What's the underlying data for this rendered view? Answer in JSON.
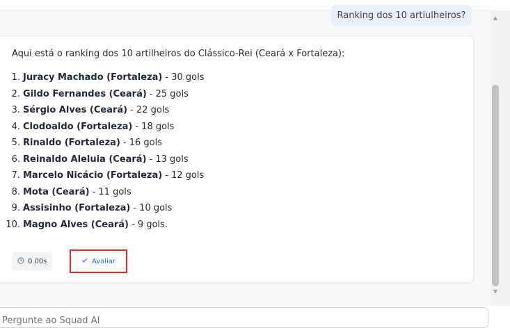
{
  "user_message": "Ranking dos 10 artiulheiros?",
  "assistant": {
    "intro": "Aqui está o ranking dos 10 artilheiros do Clássico-Rei (Ceará x Fortaleza):",
    "ranking": [
      {
        "num": "1.",
        "player": "Juracy Machado (Fortaleza)",
        "goals": "- 30 gols"
      },
      {
        "num": "2.",
        "player": "Gildo Fernandes (Ceará)",
        "goals": "- 25 gols"
      },
      {
        "num": "3.",
        "player": "Sérgio Alves (Ceará)",
        "goals": "- 22 gols"
      },
      {
        "num": "4.",
        "player": "Clodoaldo (Fortaleza)",
        "goals": "- 18 gols"
      },
      {
        "num": "5.",
        "player": "Rinaldo (Fortaleza)",
        "goals": "- 16 gols"
      },
      {
        "num": "6.",
        "player": "Reinaldo Aleluia (Ceará)",
        "goals": "- 13 gols"
      },
      {
        "num": "7.",
        "player": "Marcelo Nicácio (Fortaleza)",
        "goals": "- 12 gols"
      },
      {
        "num": "8.",
        "player": "Mota (Ceará)",
        "goals": "- 11 gols"
      },
      {
        "num": "9.",
        "player": "Assisinho (Fortaleza)",
        "goals": "- 10 gols"
      },
      {
        "num": "10.",
        "player": "Magno Alves (Ceará)",
        "goals": "- 9 gols."
      }
    ],
    "response_time": "0.00s",
    "rate_label": "Avaliar"
  },
  "input": {
    "placeholder": "Pergunte ao Squad AI"
  },
  "icons": {
    "clock": "clock-icon",
    "check": "check-icon"
  }
}
